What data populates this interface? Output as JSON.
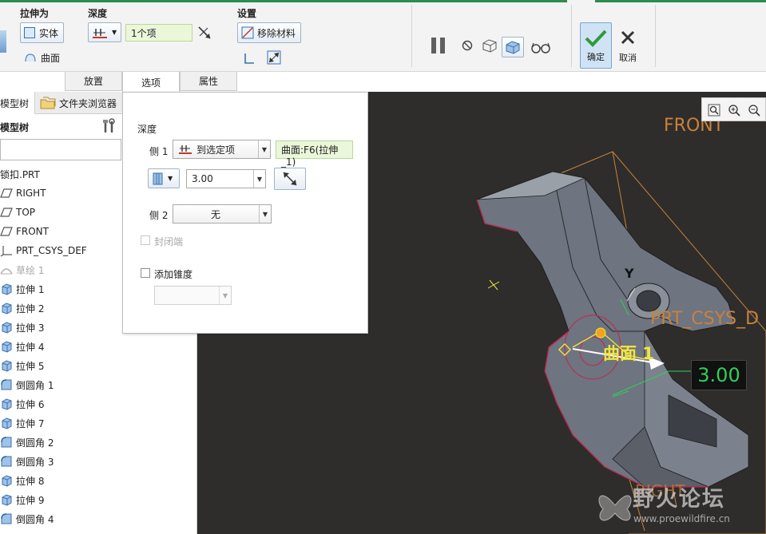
{
  "ribbon": {
    "extrude_as": {
      "label": "拉伸为",
      "solid": "实体",
      "surface": "曲面"
    },
    "depth": {
      "label": "深度",
      "value": "1个项"
    },
    "settings": {
      "label": "设置",
      "remove_material": "移除材料"
    },
    "confirm": "确定",
    "cancel": "取消"
  },
  "tabs": [
    "放置",
    "选项",
    "属性"
  ],
  "tree": {
    "tab_model": "模型树",
    "tab_browser": "文件夹浏览器",
    "title": "模型树",
    "items": [
      {
        "label": "锁扣.PRT",
        "icon": "part-icon"
      },
      {
        "label": "RIGHT",
        "icon": "datum-plane-icon"
      },
      {
        "label": "TOP",
        "icon": "datum-plane-icon"
      },
      {
        "label": "FRONT",
        "icon": "datum-plane-icon"
      },
      {
        "label": "PRT_CSYS_DEF",
        "icon": "csys-icon"
      },
      {
        "label": "草绘 1",
        "icon": "sketch-icon"
      },
      {
        "label": "拉伸 1",
        "icon": "extrude-icon"
      },
      {
        "label": "拉伸 2",
        "icon": "extrude-icon"
      },
      {
        "label": "拉伸 3",
        "icon": "extrude-icon"
      },
      {
        "label": "拉伸 4",
        "icon": "extrude-icon"
      },
      {
        "label": "拉伸 5",
        "icon": "extrude-icon"
      },
      {
        "label": "倒圆角 1",
        "icon": "round-icon"
      },
      {
        "label": "拉伸 6",
        "icon": "extrude-icon"
      },
      {
        "label": "拉伸 7",
        "icon": "extrude-icon"
      },
      {
        "label": "倒圆角 2",
        "icon": "round-icon"
      },
      {
        "label": "倒圆角 3",
        "icon": "round-icon"
      },
      {
        "label": "拉伸 8",
        "icon": "extrude-icon"
      },
      {
        "label": "拉伸 9",
        "icon": "extrude-icon"
      },
      {
        "label": "倒圆角 4",
        "icon": "round-icon"
      }
    ]
  },
  "options": {
    "depth_label": "深度",
    "side1_label": "侧 1",
    "side1_value": "到选定项",
    "side1_ref": "曲面:F6(拉伸_1)",
    "offset_value": "3.00",
    "side2_label": "侧 2",
    "side2_value": "无",
    "capped_ends": "封闭端",
    "add_taper": "添加锥度"
  },
  "viewport": {
    "front": "FRONT",
    "csys": "PRT_CSYS_D",
    "right": "RIGHT",
    "surface_label": "曲面 1",
    "dimension": "3.00",
    "axis_y": "Y",
    "watermark_title": "野火论坛",
    "watermark_url": "www.proewildfire.cn"
  },
  "colors": {
    "accent_green": "#2d8c4e",
    "viewport_bg": "#2e2d2b",
    "model_gray": "#6e7480",
    "edge_red": "#c8234a",
    "datum_orange": "#c8823c",
    "sketch_yellow": "#f3e63c"
  }
}
